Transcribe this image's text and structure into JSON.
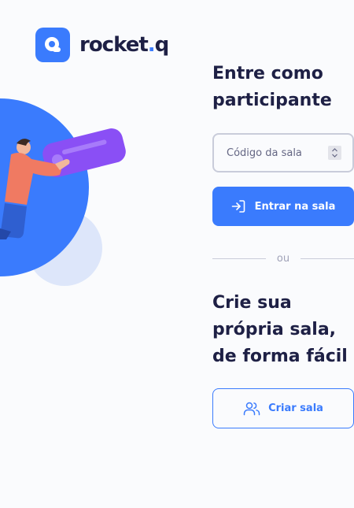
{
  "brand": {
    "name_main": "rocket",
    "name_dot": ".",
    "name_suffix": "q",
    "accent_color": "#3A7BFD",
    "text_color": "#1E2045"
  },
  "join": {
    "heading_line1": "Entre como",
    "heading_line2": "participante",
    "code_placeholder": "Código da sala",
    "code_value": "",
    "submit_label": "Entrar na sala",
    "submit_icon": "login-icon"
  },
  "divider": {
    "label": "ou"
  },
  "create": {
    "heading_line1": "Crie sua",
    "heading_line2": "própria sala,",
    "heading_line3": "de forma fácil",
    "button_label": "Criar sala",
    "button_icon": "users-icon"
  }
}
